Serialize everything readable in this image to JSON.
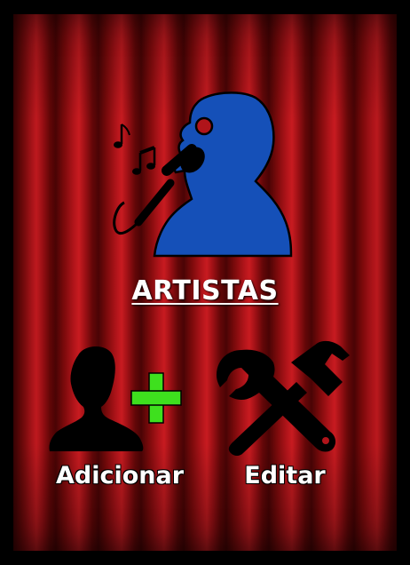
{
  "screen": {
    "title": "ARTISTAS",
    "hero_icon": "singer-with-microphone-icon",
    "background": "red-curtain"
  },
  "actions": [
    {
      "label": "Adicionar",
      "icon": "add-person-icon"
    },
    {
      "label": "Editar",
      "icon": "wrench-hammer-icon"
    }
  ],
  "colors": {
    "singer_blue": "#1550b8",
    "plus_green": "#3ee01e",
    "curtain_red": "#b0141a",
    "frame_black": "#000000"
  }
}
